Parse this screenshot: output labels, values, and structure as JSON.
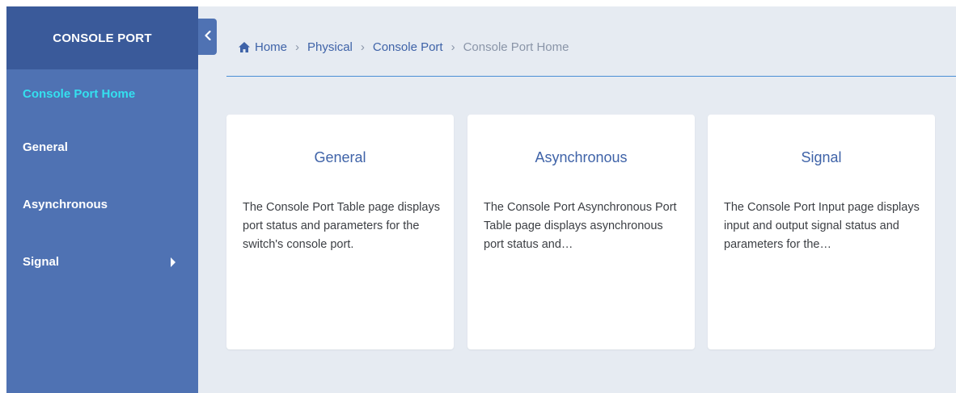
{
  "sidebar": {
    "title": "CONSOLE PORT",
    "items": [
      {
        "label": "Console Port Home"
      },
      {
        "label": "General"
      },
      {
        "label": "Asynchronous"
      },
      {
        "label": "Signal"
      }
    ]
  },
  "breadcrumb": {
    "items": [
      "Home",
      "Physical",
      "Console Port",
      "Console Port Home"
    ],
    "separator": "›"
  },
  "cards": [
    {
      "title": "General",
      "description": "The Console Port Table page displays port status and parameters for the switch's console port."
    },
    {
      "title": "Asynchronous",
      "description": "The Console Port Asynchronous Port Table page displays asynchronous port status and…"
    },
    {
      "title": "Signal",
      "description": "The Console Port Input page displays input and output signal status and parameters for the…"
    }
  ],
  "colors": {
    "sidebar": "#4f72b3",
    "sidebar_header": "#3a5a9a",
    "active_item": "#34e0ef",
    "accent": "#3f63a8",
    "content_bg": "#e6ebf2"
  },
  "icons": {
    "home": "home-icon",
    "collapse": "chevron-left-icon",
    "submenu": "caret-right-icon"
  }
}
